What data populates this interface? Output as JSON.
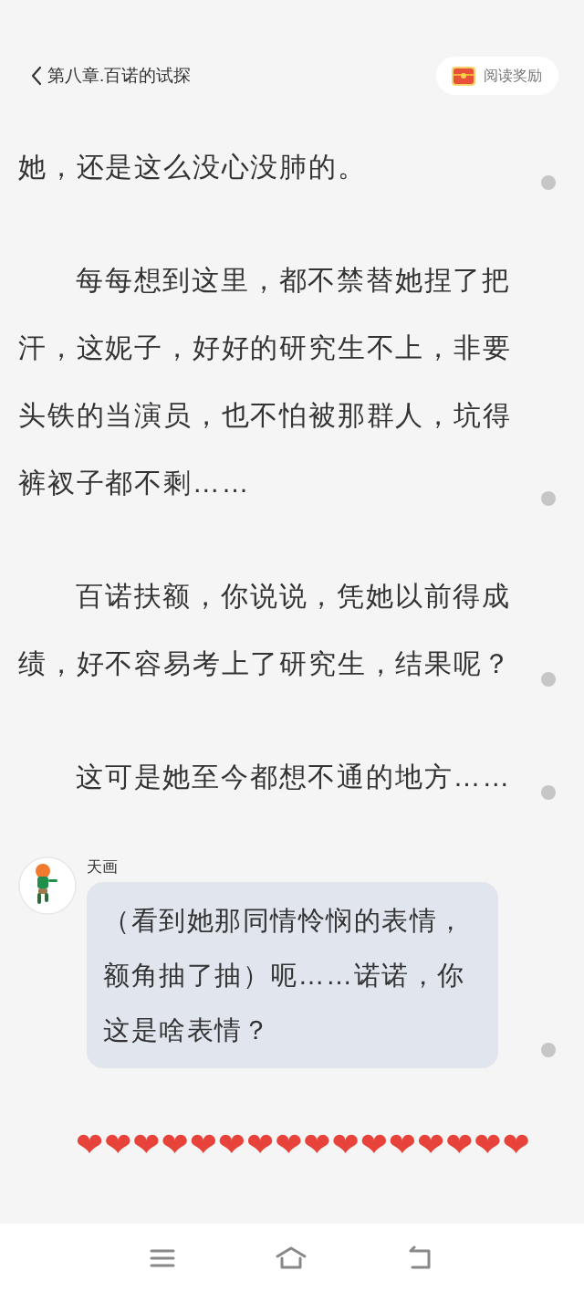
{
  "header": {
    "title": "第八章.百诺的试探",
    "reward_button": "阅读奖励"
  },
  "paragraphs": [
    {
      "kind": "text",
      "indented": false,
      "text": "她，还是这么没心没肺的。"
    },
    {
      "kind": "text",
      "indented": true,
      "text": "每每想到这里，都不禁替她捏了把汗，这妮子，好好的研究生不上，非要头铁的当演员，也不怕被那群人，坑得裤衩子都不剩……"
    },
    {
      "kind": "text",
      "indented": true,
      "text": "百诺扶额，你说说，凭她以前得成绩，好不容易考上了研究生，结果呢？"
    },
    {
      "kind": "text",
      "indented": true,
      "text": "这可是她至今都想不通的地方……"
    },
    {
      "kind": "chat",
      "speaker": "天画",
      "text": "（看到她那同情怜悯的表情，额角抽了抽）呃……诺诺，你这是啥表情？"
    },
    {
      "kind": "hearts",
      "indented": true,
      "text": "❤❤❤❤❤❤❤❤❤❤❤❤❤❤❤❤"
    }
  ]
}
